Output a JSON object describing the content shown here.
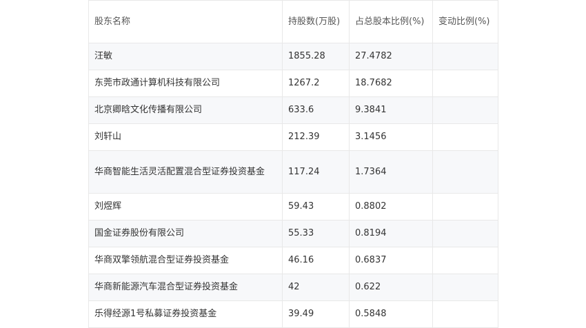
{
  "table": {
    "headers": [
      "股东名称",
      "持股数(万股)",
      "占总股本比例(%)",
      "变动比例(%)"
    ],
    "rows": [
      {
        "name": "汪敏",
        "shares": "1855.28",
        "ratio": "27.4782",
        "change": ""
      },
      {
        "name": "东莞市政通计算机科技有限公司",
        "shares": "1267.2",
        "ratio": "18.7682",
        "change": ""
      },
      {
        "name": "北京卿晗文化传播有限公司",
        "shares": "633.6",
        "ratio": "9.3841",
        "change": ""
      },
      {
        "name": "刘轩山",
        "shares": "212.39",
        "ratio": "3.1456",
        "change": ""
      },
      {
        "name": "华商智能生活灵活配置混合型证券投资基金",
        "shares": "117.24",
        "ratio": "1.7364",
        "change": ""
      },
      {
        "name": "刘煜辉",
        "shares": "59.43",
        "ratio": "0.8802",
        "change": ""
      },
      {
        "name": "国金证券股份有限公司",
        "shares": "55.33",
        "ratio": "0.8194",
        "change": ""
      },
      {
        "name": "华商双擎领航混合型证券投资基金",
        "shares": "46.16",
        "ratio": "0.6837",
        "change": ""
      },
      {
        "name": "华商新能源汽车混合型证券投资基金",
        "shares": "42",
        "ratio": "0.622",
        "change": ""
      },
      {
        "name": "乐得经源1号私募证券投资基金",
        "shares": "39.49",
        "ratio": "0.5848",
        "change": ""
      }
    ]
  }
}
